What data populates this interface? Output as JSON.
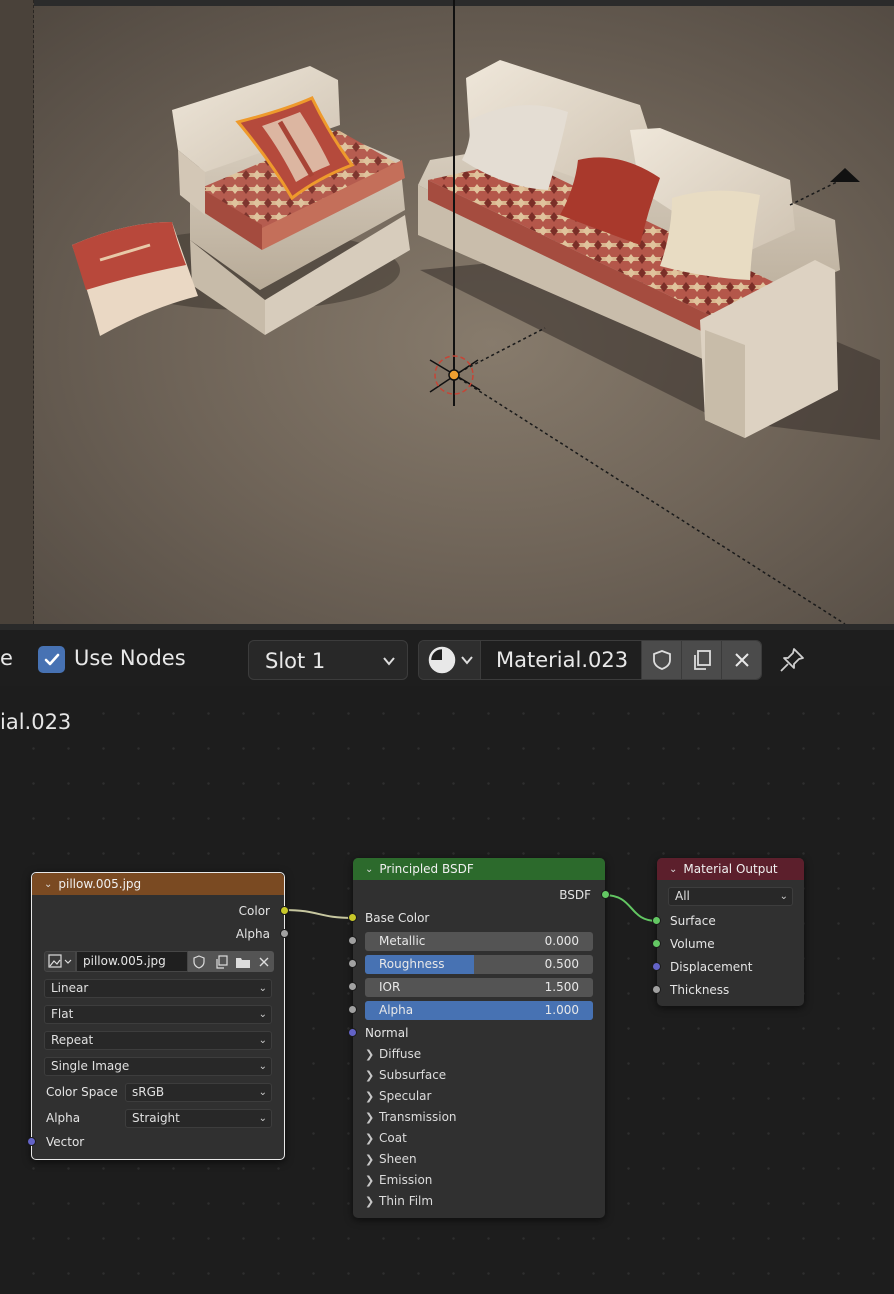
{
  "header": {
    "left_fragment": "e",
    "use_nodes_label": "Use Nodes",
    "use_nodes_checked": true,
    "slot_label": "Slot 1",
    "material_name": "Material.023"
  },
  "editor": {
    "breadcrumb_fragment": "ial.023"
  },
  "image_node": {
    "title": "pillow.005.jpg",
    "header_color": "#7a4a22",
    "outputs": [
      "Color",
      "Alpha"
    ],
    "image_name": "pillow.005.jpg",
    "interpolation": "Linear",
    "projection": "Flat",
    "extension": "Repeat",
    "source": "Single Image",
    "color_space_label": "Color Space",
    "color_space": "sRGB",
    "alpha_label": "Alpha",
    "alpha_mode": "Straight",
    "input_vector": "Vector"
  },
  "bsdf_node": {
    "title": "Principled BSDF",
    "header_color": "#2c6a2c",
    "output": "BSDF",
    "base_color": "Base Color",
    "fields": [
      {
        "label": "Metallic",
        "value": "0.000",
        "fill": 0.0
      },
      {
        "label": "Roughness",
        "value": "0.500",
        "fill": 0.5
      },
      {
        "label": "IOR",
        "value": "1.500",
        "fill": 0.0
      },
      {
        "label": "Alpha",
        "value": "1.000",
        "fill": 1.0
      }
    ],
    "normal": "Normal",
    "panels": [
      "Diffuse",
      "Subsurface",
      "Specular",
      "Transmission",
      "Coat",
      "Sheen",
      "Emission",
      "Thin Film"
    ]
  },
  "output_node": {
    "title": "Material Output",
    "header_color": "#5c1f2c",
    "target": "All",
    "inputs": [
      "Surface",
      "Volume",
      "Displacement",
      "Thickness"
    ]
  },
  "colors": {
    "accent_blue": "#4772b3",
    "socket_yellow": "#c7c729",
    "socket_grey": "#a1a1a1",
    "socket_blue": "#6363c7",
    "socket_green": "#63c763"
  }
}
